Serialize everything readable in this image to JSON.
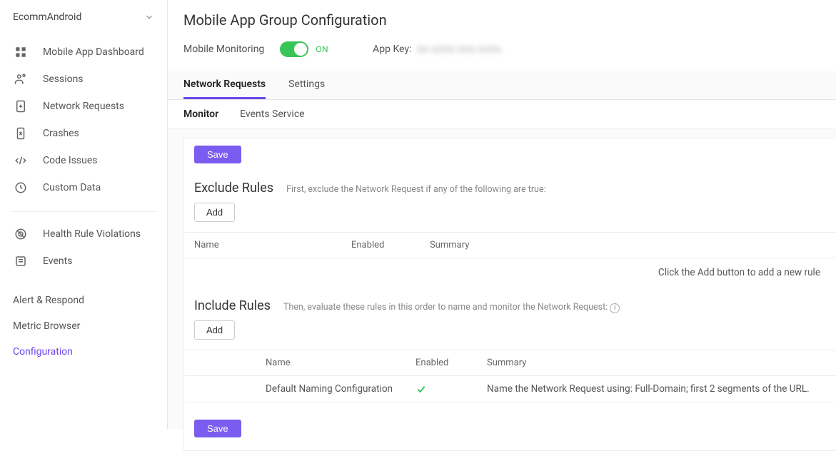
{
  "sidebar": {
    "header": "EcommAndroid",
    "primary": [
      {
        "icon": "dashboard",
        "label": "Mobile App Dashboard"
      },
      {
        "icon": "sessions",
        "label": "Sessions"
      },
      {
        "icon": "network",
        "label": "Network Requests"
      },
      {
        "icon": "crash",
        "label": "Crashes"
      },
      {
        "icon": "code",
        "label": "Code Issues"
      },
      {
        "icon": "data",
        "label": "Custom Data"
      }
    ],
    "secondary": [
      {
        "icon": "health",
        "label": "Health Rule Violations"
      },
      {
        "icon": "events",
        "label": "Events"
      }
    ],
    "bottom": [
      {
        "label": "Alert & Respond",
        "active": false
      },
      {
        "label": "Metric Browser",
        "active": false
      },
      {
        "label": "Configuration",
        "active": true
      }
    ]
  },
  "page": {
    "title": "Mobile App Group Configuration",
    "monitoring_label": "Mobile Monitoring",
    "monitoring_state": "ON",
    "appkey_label": "App Key:",
    "appkey_value": "xx-xxxx-xxx-xxxx"
  },
  "tabs": {
    "primary": [
      {
        "label": "Network Requests",
        "active": true
      },
      {
        "label": "Settings",
        "active": false
      }
    ],
    "secondary": [
      {
        "label": "Monitor",
        "active": true
      },
      {
        "label": "Events Service",
        "active": false
      }
    ]
  },
  "buttons": {
    "save": "Save",
    "add": "Add"
  },
  "exclude": {
    "title": "Exclude Rules",
    "desc": "First, exclude the Network Request if any of the following are true:",
    "columns": {
      "name": "Name",
      "enabled": "Enabled",
      "summary": "Summary"
    },
    "empty": "Click the Add button to add a new rule"
  },
  "include": {
    "title": "Include Rules",
    "desc": "Then, evaluate these rules in this order to name and monitor the Network Request:",
    "columns": {
      "name": "Name",
      "enabled": "Enabled",
      "summary": "Summary"
    },
    "rows": [
      {
        "name": "Default Naming Configuration",
        "enabled": true,
        "summary": "Name the Network Request using: Full-Domain; first 2 segments of the URL."
      }
    ]
  }
}
